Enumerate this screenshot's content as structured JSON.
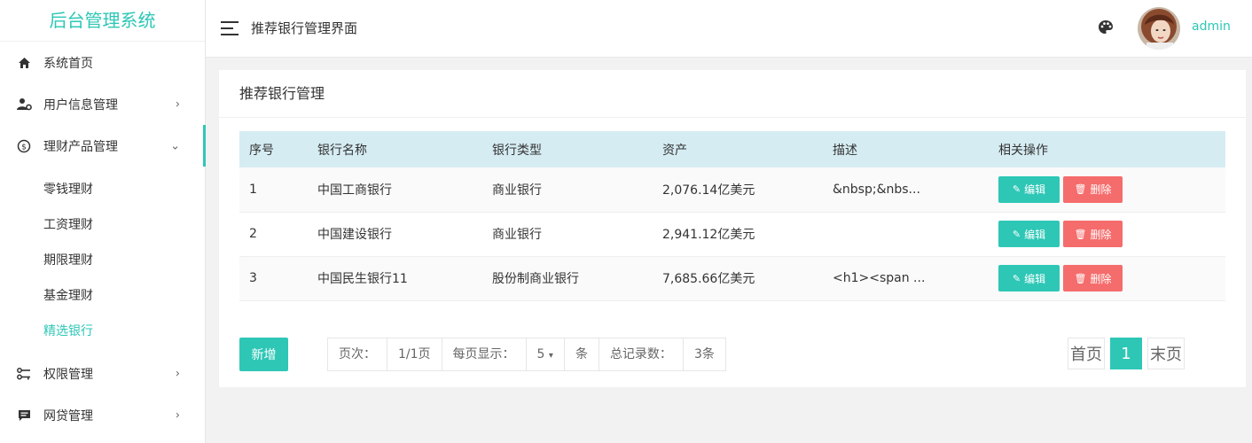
{
  "brand": "后台管理系统",
  "sidebar": {
    "items": [
      {
        "label": "系统首页"
      },
      {
        "label": "用户信息管理",
        "chevron": "›"
      },
      {
        "label": "理财产品管理",
        "chevron": "⌄"
      },
      {
        "label": "权限管理",
        "chevron": "›"
      },
      {
        "label": "网贷管理",
        "chevron": "›"
      }
    ],
    "submenu": [
      "零钱理财",
      "工资理财",
      "期限理财",
      "基金理财",
      "精选银行"
    ]
  },
  "header": {
    "title": "推荐银行管理界面",
    "username": "admin"
  },
  "card": {
    "title": "推荐银行管理"
  },
  "table": {
    "headers": [
      "序号",
      "银行名称",
      "银行类型",
      "资产",
      "描述",
      "相关操作"
    ],
    "rows": [
      [
        "1",
        "中国工商银行",
        "商业银行",
        "2,076.14亿美元",
        "&nbsp;&nbs..."
      ],
      [
        "2",
        "中国建设银行",
        "商业银行",
        "2,941.12亿美元",
        ""
      ],
      [
        "3",
        "中国民生银行11",
        "股份制商业银行",
        "7,685.66亿美元",
        "<h1><span ..."
      ]
    ],
    "edit_label": "编辑",
    "delete_label": "删除"
  },
  "footer": {
    "add_label": "新增",
    "pager": {
      "page_label": "页次：",
      "page_value": "1/1页",
      "per_page_label": "每页显示：",
      "per_page_value": "5",
      "per_page_unit": "条",
      "total_label": "总记录数：",
      "total_value": "3条"
    },
    "nav": {
      "first": "首页",
      "current": "1",
      "last": "末页"
    }
  },
  "colors": {
    "accent": "#2ec7b6",
    "danger": "#f56c6c",
    "table_header": "#d6ecf3"
  }
}
